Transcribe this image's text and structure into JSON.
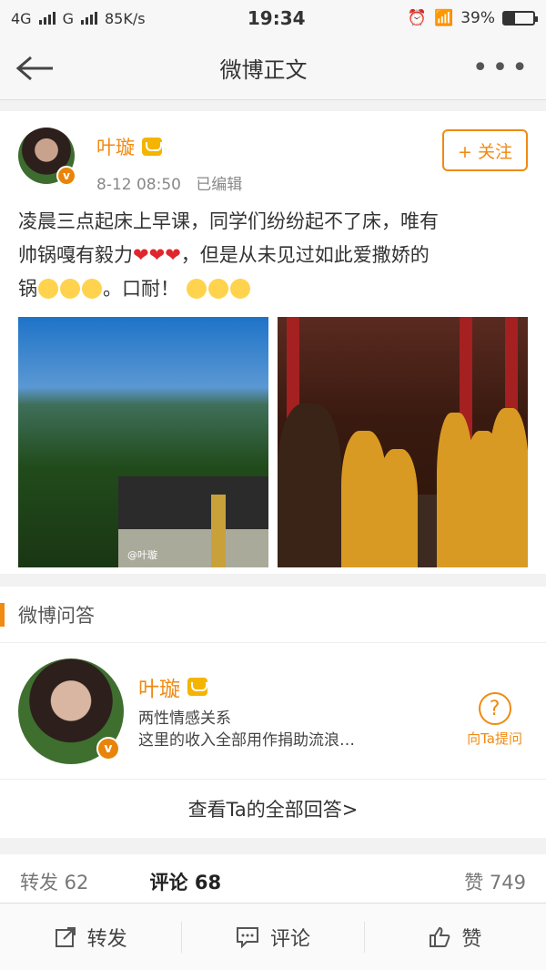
{
  "status": {
    "network1": "4G",
    "network2": "G",
    "speed": "85K/s",
    "time": "19:34",
    "battery": "39%",
    "battery_level": 0.39
  },
  "nav": {
    "title": "微博正文",
    "more": "•••"
  },
  "post": {
    "author": "叶璇",
    "avatar_badge": "v",
    "time": "8-12 08:50",
    "edited": "已编辑",
    "follow_label": "+ 关注",
    "text_line1": "凌晨三点起床上早课，同学们纷纷起不了床，唯有",
    "text_line2a": "帅锅嘎有毅力",
    "hearts": "❤❤❤",
    "text_line2b": "，但是从未见过如此爱撒娇的",
    "text_line3a": "锅",
    "text_line3b": "。口耐！",
    "watermark": "@叶璇"
  },
  "qa": {
    "section_title": "微博问答",
    "name": "叶璇",
    "line1": "两性情感关系",
    "line2": "这里的收入全部用作捐助流浪…",
    "ask_label": "向Ta提问",
    "ask_icon": "?",
    "view_all": "查看Ta的全部回答>"
  },
  "counts": {
    "repost": "转发 62",
    "comment": "评论 68",
    "like": "赞 749"
  },
  "bottom": {
    "repost": "转发",
    "comment": "评论",
    "like": "赞"
  },
  "colors": {
    "accent": "#f08a12",
    "heart": "#e0262d"
  }
}
